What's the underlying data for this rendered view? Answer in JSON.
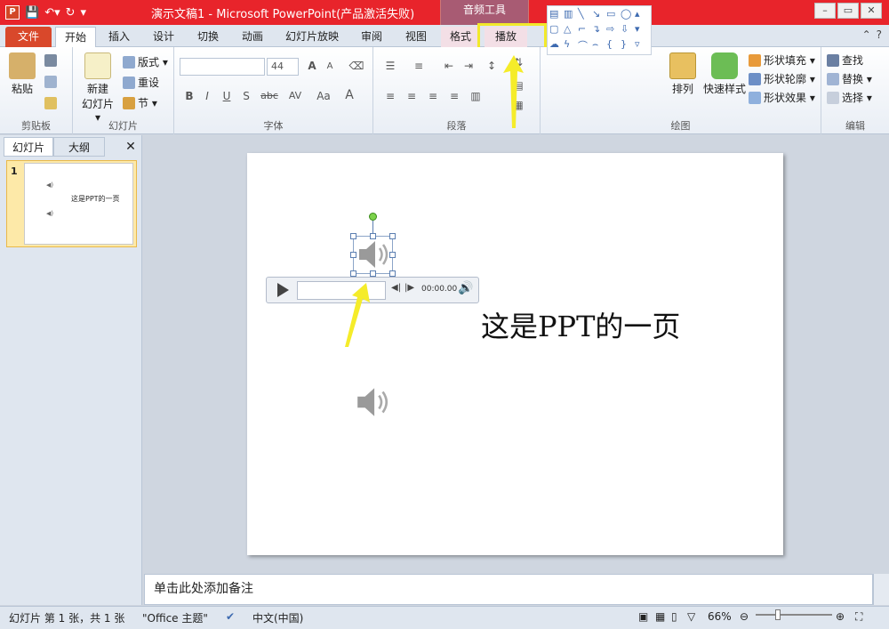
{
  "titlebar": {
    "app_icon": "P",
    "title": "演示文稿1 - Microsoft PowerPoint(产品激活失败)",
    "context_tool_group": "音频工具",
    "window_controls": [
      "–",
      "▭",
      "✕"
    ]
  },
  "tabs": {
    "file": "文件",
    "home": "开始",
    "insert": "插入",
    "design": "设计",
    "transitions": "切换",
    "animations": "动画",
    "slideshow": "幻灯片放映",
    "review": "审阅",
    "view": "视图",
    "format": "格式",
    "playback": "播放"
  },
  "ribbon": {
    "clipboard": {
      "paste": "粘贴",
      "label": "剪贴板"
    },
    "slides": {
      "new_slide_1": "新建",
      "new_slide_2": "幻灯片 ▾",
      "layout": "版式 ▾",
      "reset": "重设",
      "section": "节 ▾",
      "label": "幻灯片"
    },
    "font": {
      "size": "44",
      "bold": "B",
      "italic": "I",
      "underline": "U",
      "strike": "S",
      "abc": "abc",
      "spacing": "AV",
      "case": "Aa",
      "color": "A",
      "grow": "A",
      "shrink": "A",
      "label": "字体"
    },
    "paragraph": {
      "label": "段落"
    },
    "drawing": {
      "arrange": "排列",
      "quick_styles": "快速样式",
      "shape_fill": "形状填充 ▾",
      "shape_outline": "形状轮廓 ▾",
      "shape_effects": "形状效果 ▾",
      "label": "绘图"
    },
    "editing": {
      "find": "查找",
      "replace": "替换 ▾",
      "select": "选择 ▾",
      "label": "编辑"
    }
  },
  "left_pane": {
    "tab_slides": "幻灯片",
    "tab_outline": "大纲",
    "close": "✕",
    "thumb_number": "1",
    "thumb_text": "这是PPT的一页"
  },
  "slide": {
    "text": "这是PPT的一页",
    "player_time": "00:00.00"
  },
  "notes": {
    "placeholder": "单击此处添加备注"
  },
  "statusbar": {
    "slide_info": "幻灯片 第 1 张，共 1 张",
    "theme": "\"Office 主题\"",
    "language": "中文(中国)",
    "zoom": "66%"
  }
}
